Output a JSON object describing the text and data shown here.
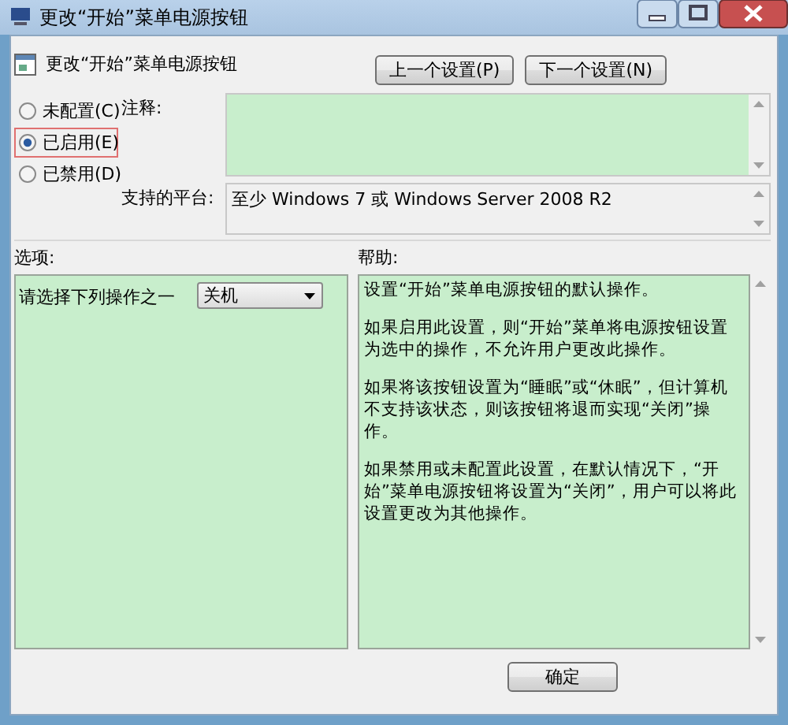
{
  "window": {
    "title": "更改“开始”菜单电源按钮"
  },
  "header": {
    "title": "更改“开始”菜单电源按钮"
  },
  "nav_buttons": [
    "上一个设置(P)",
    "下一个设置(N)"
  ],
  "radios": [
    {
      "label": "未配置(C)",
      "selected": false
    },
    {
      "label": "已启用(E)",
      "selected": true
    },
    {
      "label": "已禁用(D)",
      "selected": false
    }
  ],
  "comment": {
    "label": "注释:"
  },
  "platform": {
    "label": "支持的平台:",
    "value": "至少 Windows 7 或 Windows Server 2008 R2"
  },
  "options": {
    "label": "选项:",
    "prompt": "请选择下列操作之一",
    "dropdown": {
      "value": "关机"
    }
  },
  "help": {
    "label": "帮助:",
    "paragraphs": [
      "设置“开始”菜单电源按钮的默认操作。",
      "如果启用此设置，则“开始”菜单将电源按钮设置为选中的操作，不允许用户更改此操作。",
      "如果将该按钮设置为“睡眠”或“休眠”，但计算机不支持该状态，则该按钮将退而实现“关闭”操作。",
      "如果禁用或未配置此设置，在默认情况下，“开始”菜单电源按钮将设置为“关闭”，用户可以将此设置更改为其他操作。"
    ]
  },
  "footer_buttons": [
    "确定"
  ]
}
